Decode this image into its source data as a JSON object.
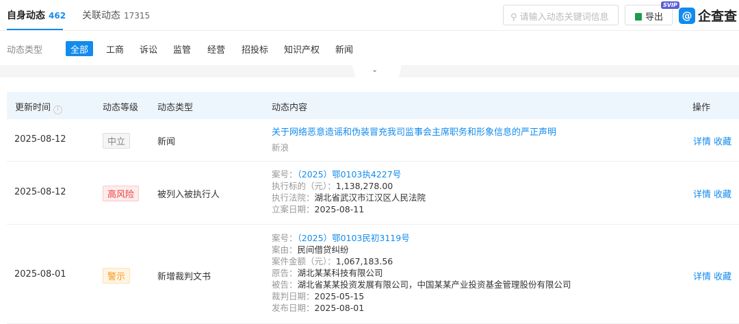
{
  "tabs": [
    {
      "label": "自身动态",
      "count": "462"
    },
    {
      "label": "关联动态",
      "count": "17315"
    }
  ],
  "search": {
    "placeholder": "请输入动态关键词信息"
  },
  "export_label": "导出",
  "svip_badge": "SVIP",
  "logo_text": "企查查",
  "filter": {
    "label": "动态类型",
    "options": [
      "全部",
      "工商",
      "诉讼",
      "监管",
      "经营",
      "招投标",
      "知识产权",
      "新闻"
    ],
    "selected": "全部"
  },
  "table": {
    "headers": [
      "更新时间",
      "动态等级",
      "动态类型",
      "动态内容",
      "操作"
    ],
    "actions": [
      "详情",
      "收藏"
    ],
    "rows": [
      {
        "date": "2025-08-12",
        "level": "中立",
        "type": "新闻",
        "title": "关于网络恶意造谣和伪装冒充我司监事会主席职务和形象信息的严正声明",
        "source": "新浪"
      },
      {
        "date": "2025-08-12",
        "level": "高风险",
        "type": "被列入被执行人",
        "fields": [
          {
            "label": "案号：",
            "value": "（2025）鄂0103执4227号"
          },
          {
            "label": "执行标的（元）：",
            "value": "1,138,278.00"
          },
          {
            "label": "执行法院：",
            "value": "湖北省武汉市江汉区人民法院"
          },
          {
            "label": "立案日期：",
            "value": "2025-08-11"
          }
        ]
      },
      {
        "date": "2025-08-01",
        "level": "警示",
        "type": "新增裁判文书",
        "fields": [
          {
            "label": "案号：",
            "value": "（2025）鄂0103民初3119号"
          },
          {
            "label": "案由：",
            "value": "民间借贷纠纷"
          },
          {
            "label": "案件金额（元）：",
            "value": "1,067,183.56"
          },
          {
            "label": "原告：",
            "value": "湖北某某科技有限公司"
          },
          {
            "label": "被告：",
            "value": "湖北省某某投资发展有限公司，中国某某产业投资基金管理股份有限公司"
          },
          {
            "label": "裁判日期：",
            "value": "2025-05-15"
          },
          {
            "label": "发布日期：",
            "value": "2025-08-01"
          }
        ]
      }
    ]
  }
}
